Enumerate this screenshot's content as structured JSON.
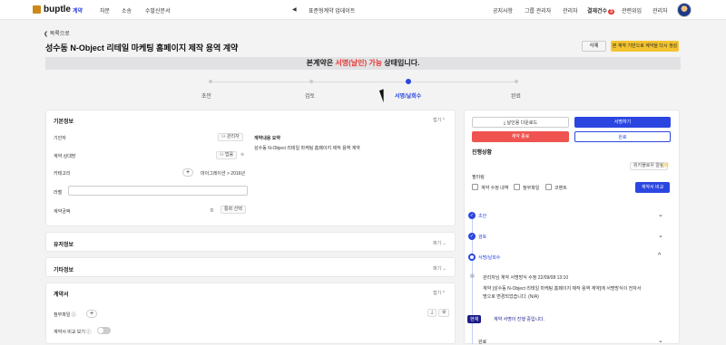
{
  "app": {
    "logo": "buptle"
  },
  "nav": {
    "contract": "계약",
    "consult": "자문",
    "litigation": "소송",
    "submission": "수발신문서",
    "announcement": "표준형계약 업데이트"
  },
  "header_right": {
    "notice": "공지사항",
    "group_admin": "그룹 관리자",
    "admin": "관리자",
    "approval": "결재건수",
    "approval_count": "3",
    "related": "관련위임",
    "manager": "관리자"
  },
  "back": "목록으로",
  "title": "성수동 N-Object 리테일 마케팅 홈페이지 제작 용역 계약",
  "buttons": {
    "delete": "삭제",
    "regen": "본 계약 기반으로 계약을 다시 생성"
  },
  "banner": {
    "pre": "본계약은 ",
    "highlight": "서명(날인) 가능",
    "post": " 상태입니다."
  },
  "steps": [
    {
      "label": "초안"
    },
    {
      "label": "검토"
    },
    {
      "label": "서명/날회수"
    },
    {
      "label": "완료"
    }
  ],
  "basic": {
    "title": "기본정보",
    "fold": "접기 ^",
    "contractor_label": "기안자",
    "contractor_value": "관리자",
    "counterpart_label": "계약 상대방",
    "counterpart_value": "법률",
    "category_label": "카테고리",
    "category_value": "마이그레이션 > 2016년",
    "label_label": "라벨",
    "amount_label": "계약금액",
    "amount_value": "0",
    "amount_btn": "통화 선택",
    "summary_label": "계약내용 요약",
    "summary_value": "성수동 N-Object 리테일 마케팅 홈페이지 제작 용역 계약"
  },
  "sections": {
    "extra": "유저정보",
    "extra_fold": "펴기 ⌄",
    "other": "기타정보",
    "other_fold": "펴기 ⌄",
    "contract": "계약서",
    "contract_fold": "접기 ^"
  },
  "attach": {
    "label": "첨부파일 ⓘ",
    "compare_label": "계약서 비교 보기 ⓘ"
  },
  "right": {
    "download": "날인용 다운로드",
    "sign": "서명하기",
    "cancel": "계약 종료",
    "complete": "완료",
    "progress": "진행상황",
    "mail": "위키플로우 알림",
    "filter": "필터링",
    "f1": "계약 수정 내역",
    "f2": "첨부파일",
    "f3": "코멘트",
    "compare": "계약서 비교",
    "tl1": "초안",
    "tl2": "검토",
    "tl3": "서명/날회수",
    "log_meta": "관리자님 계약 서명방식 수정 22/09/08 13:10",
    "log_body1": "계약 [성수동 N-Object 리테일 마케팅 홈페이지 제작 용역 계약]에 서명방식이 전자서",
    "log_body2": "명으로 변경되었습니다. (N/A)",
    "now_tag": "현재",
    "now_text": "계약 서명이 진행 중입니다.",
    "tl4": "완료"
  },
  "colors": {
    "accent": "#2b46e0",
    "danger": "#e53935",
    "warn": "#f4c430"
  }
}
